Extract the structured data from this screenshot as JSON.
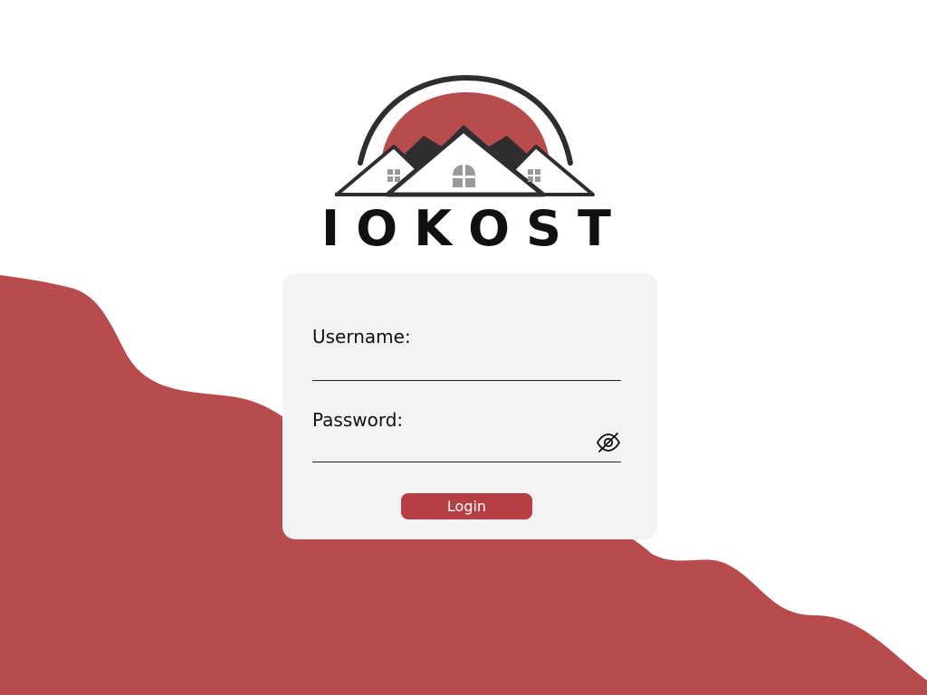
{
  "brand": {
    "name_letters": [
      "I",
      "O",
      "K",
      "O",
      "S",
      "T"
    ],
    "logo_icon": "houses-roof-icon",
    "accent_color": "#b84b4c"
  },
  "login_form": {
    "username_label": "Username:",
    "username_value": "",
    "password_label": "Password:",
    "password_value": "",
    "password_toggle_icon": "eye-slash-icon",
    "login_label": "Login"
  },
  "colors": {
    "background": "#ffffff",
    "wave": "#b84b4c",
    "card": "#f3f3f3",
    "button": "#b63f44"
  }
}
